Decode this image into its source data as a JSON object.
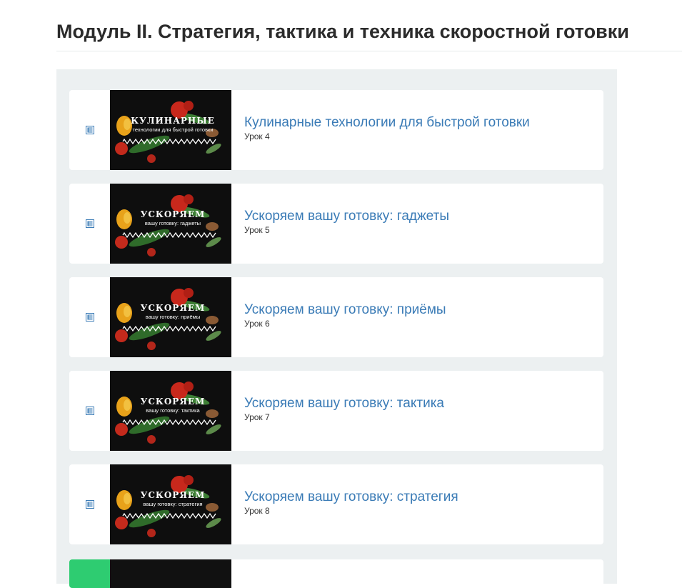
{
  "module": {
    "title": "Модуль II. Стратегия, тактика и техника скоростной готовки"
  },
  "colors": {
    "panel_bg": "#ecf0f1",
    "link": "#3a7bb6",
    "icon": "#3a7bb6",
    "completed_strip": "#2ecc71"
  },
  "lessons": [
    {
      "title": "Кулинарные технологии для быстрой готовки",
      "subtitle": "Урок 4",
      "icon": "lesson-document-icon",
      "thumb_heading": "КУЛИНАРНЫЕ",
      "thumb_caption": "технологии для быстрой готовки"
    },
    {
      "title": "Ускоряем вашу готовку: гаджеты",
      "subtitle": "Урок 5",
      "icon": "lesson-document-icon",
      "thumb_heading": "УСКОРЯЕМ",
      "thumb_caption": "вашу готовку: гаджеты"
    },
    {
      "title": "Ускоряем вашу готовку: приёмы",
      "subtitle": "Урок 6",
      "icon": "lesson-document-icon",
      "thumb_heading": "УСКОРЯЕМ",
      "thumb_caption": "вашу готовку: приёмы"
    },
    {
      "title": "Ускоряем вашу готовку: тактика",
      "subtitle": "Урок 7",
      "icon": "lesson-document-icon",
      "thumb_heading": "УСКОРЯЕМ",
      "thumb_caption": "вашу готовку: тактика"
    },
    {
      "title": "Ускоряем вашу готовку: стратегия",
      "subtitle": "Урок 8",
      "icon": "lesson-document-icon",
      "thumb_heading": "УСКОРЯЕМ",
      "thumb_caption": "вашу готовку: стратегия"
    }
  ]
}
